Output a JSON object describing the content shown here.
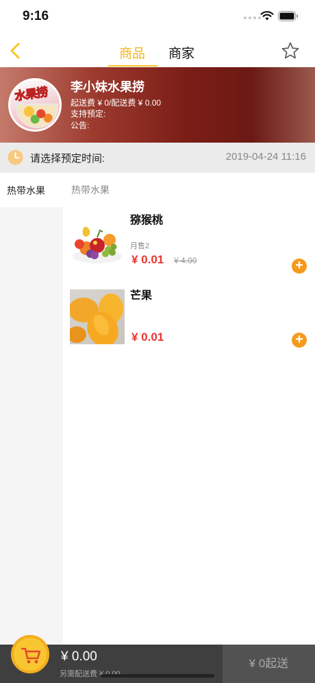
{
  "status_bar": {
    "time": "9:16"
  },
  "nav": {
    "tabs": [
      {
        "label": "商品",
        "active": true
      },
      {
        "label": "商家",
        "active": false
      }
    ],
    "accent_color": "#f5b51a",
    "icons": {
      "back": "chevron-left-icon",
      "favorite": "star-icon"
    }
  },
  "store": {
    "logo_text": "水果捞",
    "name": "李小妹水果捞",
    "fee_line": "起送费 ¥ 0/配送费 ¥ 0.00",
    "preorder_line": "支持预定:",
    "notice_line": "公告:"
  },
  "reservation": {
    "label": "请选择预定时间:",
    "time": "2019-04-24 11:16"
  },
  "sidebar": {
    "items": [
      {
        "label": "热带水果",
        "selected": true
      }
    ]
  },
  "section": {
    "title": "热带水果"
  },
  "products": [
    {
      "name": "猕猴桃",
      "sales": "月售2",
      "price": "¥ 0.01",
      "old_price": "¥ 4.00"
    },
    {
      "name": "芒果",
      "price": "¥ 0.01"
    }
  ],
  "cart": {
    "total": "¥ 0.00",
    "delivery_note": "另需配送费 ¥ 0.00",
    "checkout_label": "¥ 0起送"
  },
  "colors": {
    "price": "#e8352f",
    "add_button": "#f59a1c",
    "cart_bar": "#3f3f3f"
  }
}
